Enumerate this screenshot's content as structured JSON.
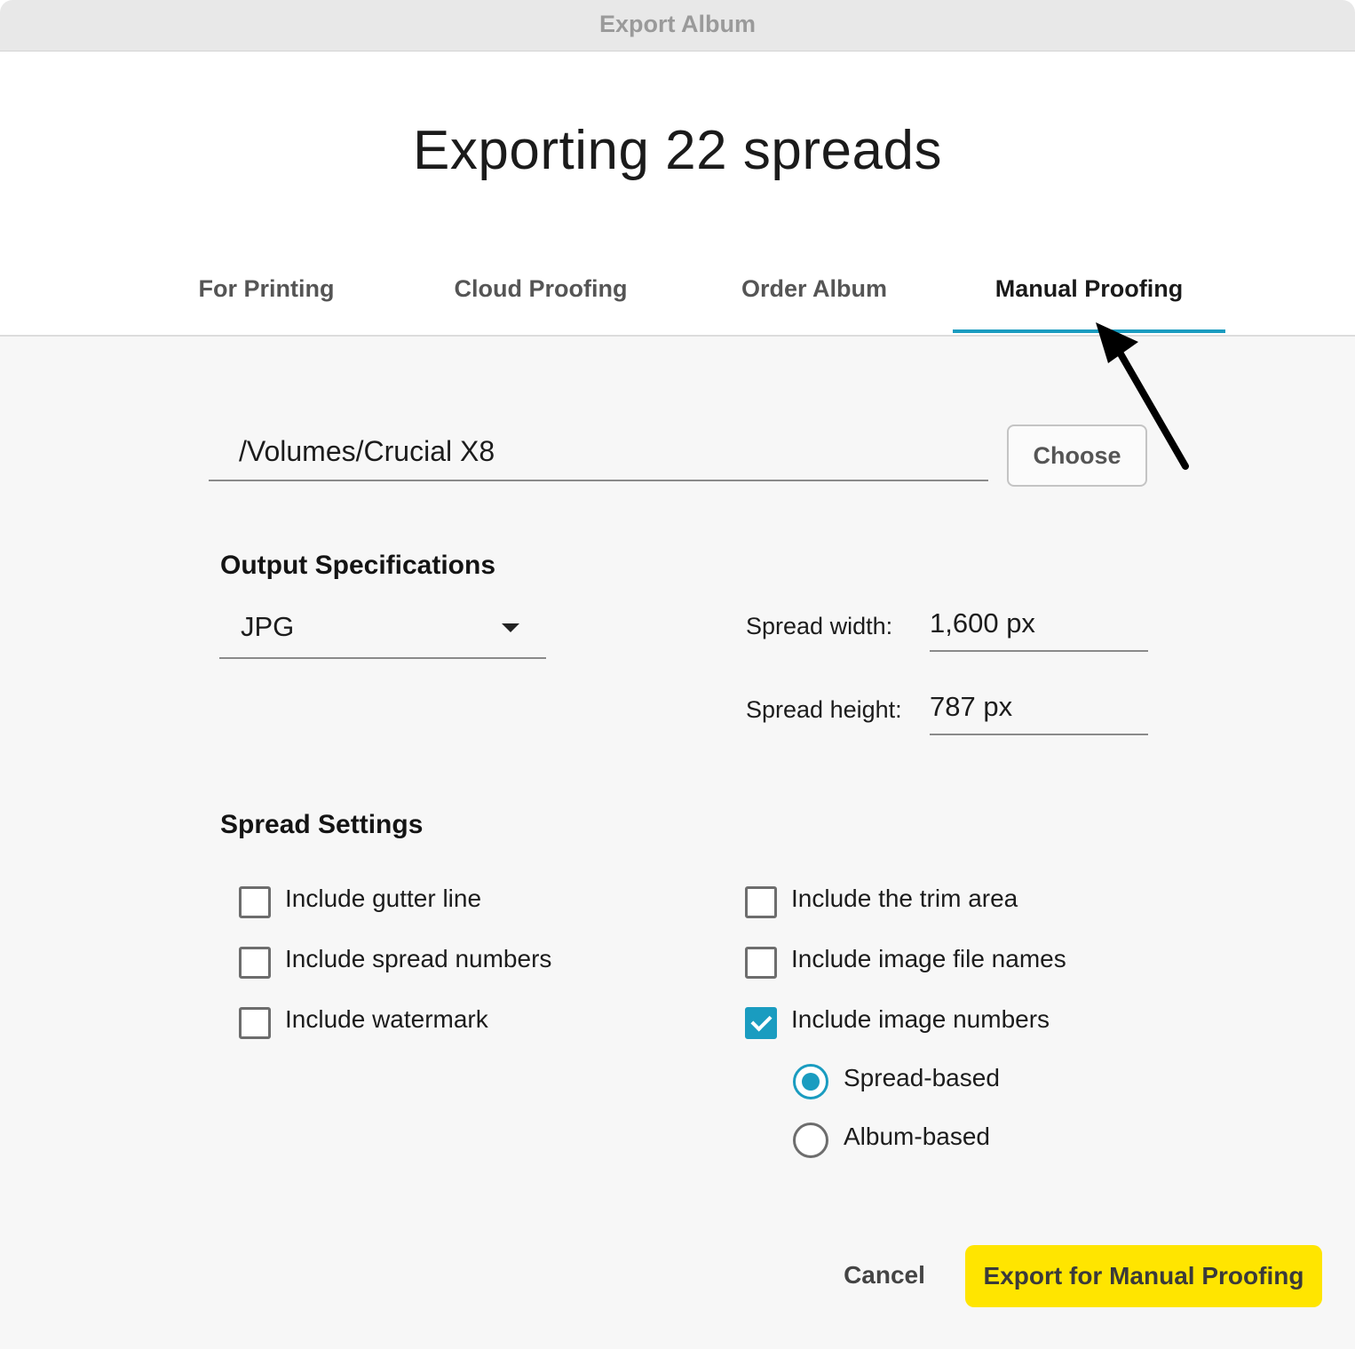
{
  "window": {
    "title": "Export Album"
  },
  "heading": "Exporting 22 spreads",
  "tabs": [
    {
      "label": "For Printing",
      "active": false
    },
    {
      "label": "Cloud Proofing",
      "active": false
    },
    {
      "label": "Order Album",
      "active": false
    },
    {
      "label": "Manual Proofing",
      "active": true
    }
  ],
  "destination": {
    "path": "/Volumes/Crucial X8",
    "choose_label": "Choose"
  },
  "output": {
    "title": "Output Specifications",
    "format": "JPG",
    "spread_width_label": "Spread width:",
    "spread_width_value": "1,600 px",
    "spread_height_label": "Spread height:",
    "spread_height_value": "787 px"
  },
  "spread_settings": {
    "title": "Spread Settings",
    "left": [
      {
        "label": "Include gutter line",
        "checked": false
      },
      {
        "label": "Include spread numbers",
        "checked": false
      },
      {
        "label": "Include watermark",
        "checked": false
      }
    ],
    "right": [
      {
        "label": "Include the trim area",
        "checked": false
      },
      {
        "label": "Include image file names",
        "checked": false
      },
      {
        "label": "Include image numbers",
        "checked": true
      }
    ],
    "numbering": [
      {
        "label": "Spread-based",
        "selected": true
      },
      {
        "label": "Album-based",
        "selected": false
      }
    ]
  },
  "actions": {
    "cancel_label": "Cancel",
    "export_label": "Export for Manual Proofing"
  },
  "colors": {
    "accent": "#1a9cc0",
    "primary_button": "#ffe500"
  },
  "icons": {
    "arrow": "arrow-pointer-icon",
    "dropdown": "caret-down-icon",
    "check": "checkmark-icon"
  }
}
